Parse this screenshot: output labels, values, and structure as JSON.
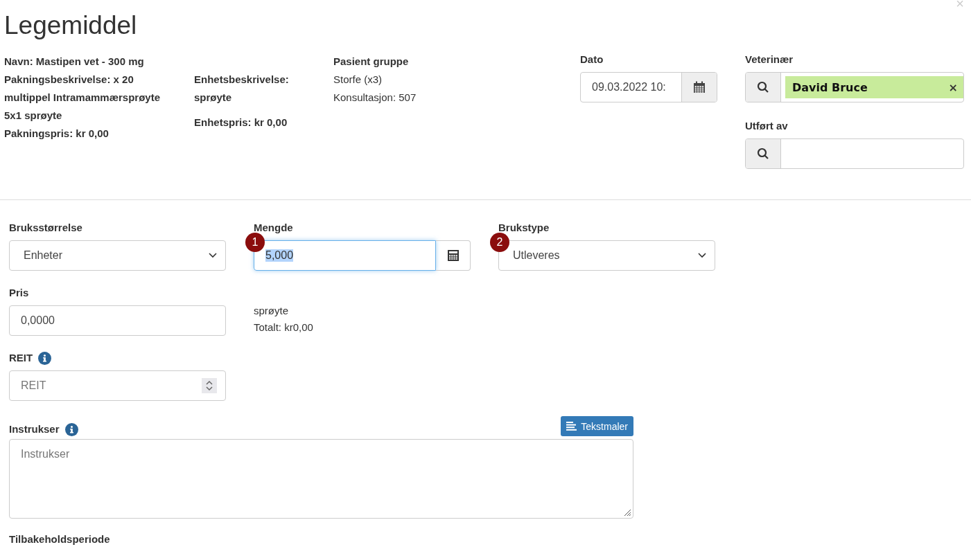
{
  "dialog": {
    "title": "Legemiddel",
    "close": "×"
  },
  "info": {
    "col1": [
      "Navn: Mastipen vet - 300 mg",
      "Pakningsbeskrivelse: x 20 multippel Intramammærsprøyte 5x1 sprøyte",
      "Pakningspris: kr 0,00"
    ],
    "col2": [
      "Enhetsbeskrivelse: sprøyte",
      "Enhetspris: kr 0,00"
    ],
    "patient_group": {
      "label": "Pasient gruppe",
      "lines": [
        "Storfe (x3)",
        "Konsultasjon: 507"
      ]
    }
  },
  "date": {
    "label": "Dato",
    "value": "09.03.2022 10:"
  },
  "vet": {
    "label": "Veterinær",
    "value": "David Bruce",
    "remove": "×"
  },
  "performed_by": {
    "label": "Utført av"
  },
  "form": {
    "usage_size": {
      "label": "Bruksstørrelse",
      "value": "Enheter"
    },
    "amount": {
      "label": "Mengde",
      "value": "5,000",
      "focused": true,
      "badge": "1"
    },
    "usage_type": {
      "label": "Brukstype",
      "value": "Utleveres",
      "badge": "2"
    },
    "price": {
      "label": "Pris",
      "value": "0,0000"
    },
    "unit_summary": [
      "sprøyte",
      "Totalt: kr0,00"
    ],
    "reit": {
      "label": "REIT",
      "placeholder": "REIT"
    },
    "instructions": {
      "label": "Instrukser",
      "placeholder": "Instrukser",
      "button": "Tekstmaler"
    },
    "withdrawal": {
      "label": "Tilbakeholdsperiode"
    }
  }
}
